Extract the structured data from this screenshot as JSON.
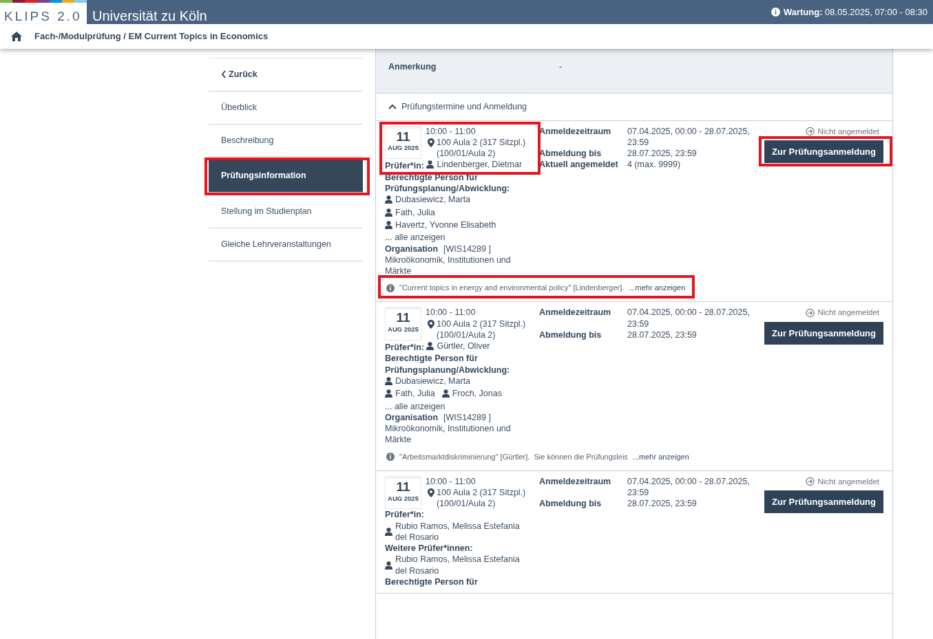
{
  "header": {
    "logo": "KLIPS 2.0",
    "university": "Universität zu Köln",
    "maintenance_label": "Wartung:",
    "maintenance_text": "08.05.2025, 07:00 - 08:30"
  },
  "breadcrumb": "Fach-/Modulprüfung / EM Current Topics in Economics",
  "sidebar": {
    "back": "Zurück",
    "items": [
      {
        "label": "Überblick",
        "selected": false,
        "highlighted": false
      },
      {
        "label": "Beschreibung",
        "selected": false,
        "highlighted": false
      },
      {
        "label": "Prüfungsinformation",
        "selected": true,
        "highlighted": true
      },
      {
        "label": "Stellung im Studienplan",
        "selected": false,
        "highlighted": false
      },
      {
        "label": "Gleiche Lehrveranstaltungen",
        "selected": false,
        "highlighted": false
      }
    ]
  },
  "details": [
    {
      "label": "Anmerkung",
      "value": "-"
    }
  ],
  "section": {
    "title": "Prüfungstermine und Anmeldung",
    "expanded": true
  },
  "exams": [
    {
      "highlighted": true,
      "day": "11",
      "month_year": "AUG 2025",
      "time": "10:00 - 11:00",
      "room": "100 Aula 2 (317 Sitzpl.) (100/01/Aula 2)",
      "groups": [
        {
          "label": "Prüfer*in:",
          "people": [
            "Lindenberger, Dietmar"
          ]
        },
        {
          "label": "Berechtigte Person für Prüfungsplanung/Abwicklung:",
          "people": [
            "Dubasiewicz, Marta",
            "Fath, Julia",
            "Havertz, Yvonne Elisabeth"
          ],
          "more": "... alle anzeigen"
        }
      ],
      "organisation": {
        "label": "Organisation",
        "code": "[WIS14289 ]",
        "name": "Mikroökonomik, Institutionen und Märkte"
      },
      "fields": [
        {
          "label": "Anmeldezeitraum",
          "value": "07.04.2025, 00:00 - 28.07.2025, 23:59"
        },
        {
          "label": "Abmeldung bis",
          "value": "28.07.2025, 23:59"
        },
        {
          "label": "Aktuell angemeldet",
          "value": "4 (max. 9999)"
        }
      ],
      "status": "Nicht angemeldet",
      "button": "Zur Prüfungsanmeldung",
      "note": {
        "text": "\"Current topics in energy and environmental policy\" [Lindenberger].",
        "link": "...mehr anzeigen"
      }
    },
    {
      "highlighted": false,
      "day": "11",
      "month_year": "AUG 2025",
      "time": "10:00 - 11:00",
      "room": "100 Aula 2 (317 Sitzpl.) (100/01/Aula 2)",
      "groups": [
        {
          "label": "Prüfer*in:",
          "people": [
            "Gürtler, Oliver"
          ]
        },
        {
          "label": "Berechtigte Person für Prüfungsplanung/Abwicklung:",
          "people": [
            "Dubasiewicz, Marta",
            "Fath, Julia",
            "Froch, Jonas"
          ],
          "more": "... alle anzeigen"
        }
      ],
      "organisation": {
        "label": "Organisation",
        "code": "[WIS14289 ]",
        "name": "Mikroökonomik, Institutionen und Märkte"
      },
      "fields": [
        {
          "label": "Anmeldezeitraum",
          "value": "07.04.2025, 00:00 - 28.07.2025, 23:59"
        },
        {
          "label": "Abmeldung bis",
          "value": "28.07.2025, 23:59"
        }
      ],
      "status": "Nicht angemeldet",
      "button": "Zur Prüfungsanmeldung",
      "note": {
        "text": "\"Arbeitsmarktdiskriminierung\" [Gürtler].  Sie können die Prüfungsleis",
        "link": "...mehr anzeigen"
      }
    },
    {
      "highlighted": false,
      "day": "11",
      "month_year": "AUG 2025",
      "time": "10:00 - 11:00",
      "room": "100 Aula 2 (317 Sitzpl.) (100/01/Aula 2)",
      "groups": [
        {
          "label": "Prüfer*in:",
          "people": [
            "Rubio Ramos, Melissa Estefania del Rosario"
          ]
        },
        {
          "label": "Weitere Prüfer*innen:",
          "people": [
            "Rubio Ramos, Melissa Estefania del Rosario"
          ]
        },
        {
          "label": "Berechtigte Person für"
        }
      ],
      "fields": [
        {
          "label": "Anmeldezeitraum",
          "value": "07.04.2025, 00:00 - 28.07.2025, 23:59"
        },
        {
          "label": "Abmeldung bis",
          "value": "28.07.2025, 23:59"
        }
      ],
      "status": "Nicht angemeldet",
      "button": "Zur Prüfungsanmeldung"
    }
  ]
}
